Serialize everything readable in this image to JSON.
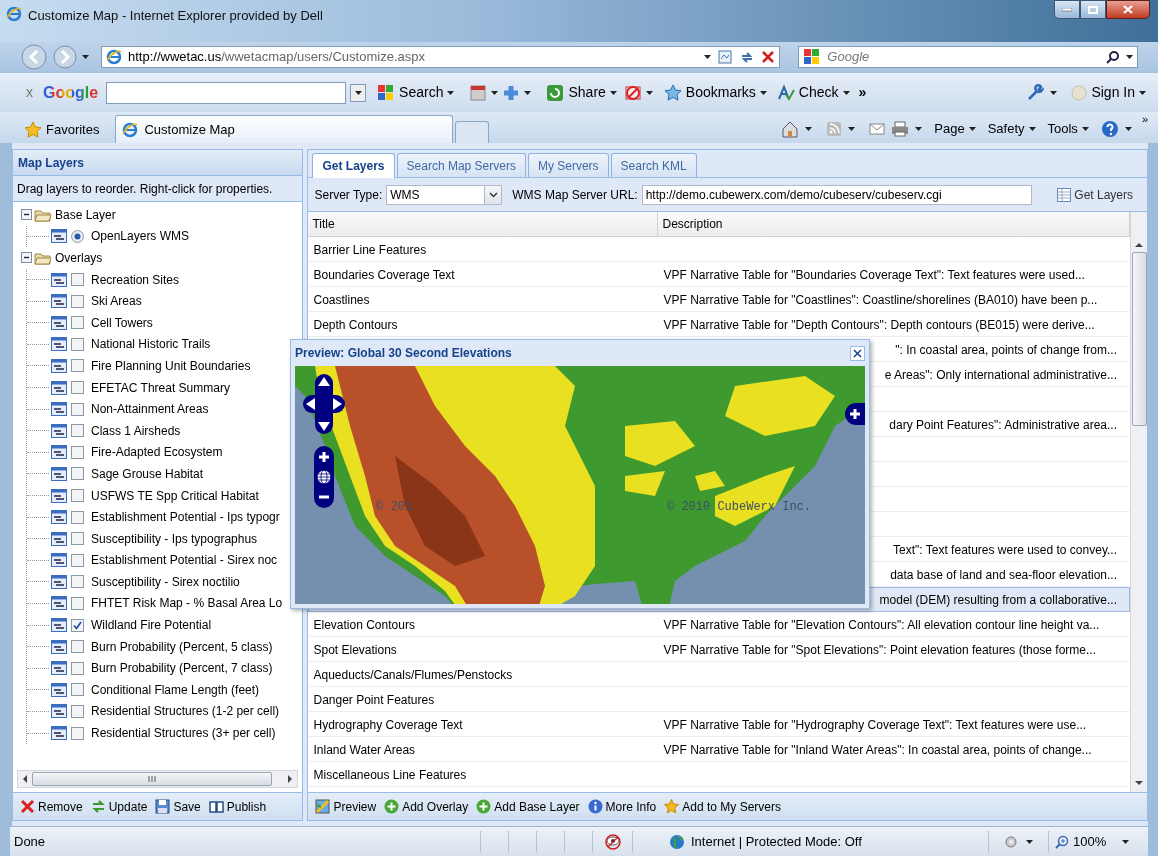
{
  "window": {
    "title": "Customize Map - Internet Explorer provided by Dell"
  },
  "address_bar": {
    "url_host": "http://wwetac.us",
    "url_path": "/wwetacmap/users/Customize.aspx"
  },
  "search_box": {
    "placeholder": "Google"
  },
  "google_toolbar": {
    "close": "x",
    "logo": "Google",
    "items": [
      {
        "label": "Search"
      },
      {
        "label": "Share"
      },
      {
        "label": "Bookmarks"
      },
      {
        "label": "Check"
      }
    ],
    "more": "»",
    "sign_in": "Sign In"
  },
  "favorites_bar": {
    "favorites": "Favorites",
    "tabs": [
      {
        "label": "Customize Map",
        "selected": true
      }
    ],
    "commands": [
      "Page",
      "Safety",
      "Tools"
    ],
    "more": "»"
  },
  "left_panel": {
    "title": "Map Layers",
    "hint": "Drag layers to reorder. Right-click for properties.",
    "tree": [
      {
        "label": "Base Layer",
        "expanded": true,
        "children": [
          {
            "label": "OpenLayers WMS",
            "kind": "radio",
            "checked": true
          }
        ]
      },
      {
        "label": "Overlays",
        "expanded": true,
        "children": [
          {
            "label": "Recreation Sites",
            "kind": "checkbox",
            "checked": false
          },
          {
            "label": "Ski Areas",
            "kind": "checkbox",
            "checked": false
          },
          {
            "label": "Cell Towers",
            "kind": "checkbox",
            "checked": false
          },
          {
            "label": "National Historic Trails",
            "kind": "checkbox",
            "checked": false
          },
          {
            "label": "Fire Planning Unit Boundaries",
            "kind": "checkbox",
            "checked": false
          },
          {
            "label": "EFETAC Threat Summary",
            "kind": "checkbox",
            "checked": false
          },
          {
            "label": "Non-Attainment Areas",
            "kind": "checkbox",
            "checked": false
          },
          {
            "label": "Class 1 Airsheds",
            "kind": "checkbox",
            "checked": false
          },
          {
            "label": "Fire-Adapted Ecosystem",
            "kind": "checkbox",
            "checked": false
          },
          {
            "label": "Sage Grouse Habitat",
            "kind": "checkbox",
            "checked": false
          },
          {
            "label": "USFWS TE Spp Critical Habitat",
            "kind": "checkbox",
            "checked": false
          },
          {
            "label": "Establishment Potential - Ips typogr",
            "kind": "checkbox",
            "checked": false
          },
          {
            "label": "Susceptibility - Ips typographus",
            "kind": "checkbox",
            "checked": false
          },
          {
            "label": "Establishment Potential - Sirex noc",
            "kind": "checkbox",
            "checked": false
          },
          {
            "label": "Susceptibility - Sirex noctilio",
            "kind": "checkbox",
            "checked": false
          },
          {
            "label": "FHTET Risk Map - % Basal Area Lo",
            "kind": "checkbox",
            "checked": false
          },
          {
            "label": "Wildland Fire Potential",
            "kind": "checkbox",
            "checked": true
          },
          {
            "label": "Burn Probability (Percent, 5 class)",
            "kind": "checkbox",
            "checked": false
          },
          {
            "label": "Burn Probability (Percent, 7 class)",
            "kind": "checkbox",
            "checked": false
          },
          {
            "label": "Conditional Flame Length (feet)",
            "kind": "checkbox",
            "checked": false
          },
          {
            "label": "Residential Structures (1-2 per cell)",
            "kind": "checkbox",
            "checked": false
          },
          {
            "label": "Residential Structures (3+ per cell)",
            "kind": "checkbox",
            "checked": false
          }
        ]
      }
    ],
    "toolbar": [
      {
        "kind": "remove",
        "label": "Remove"
      },
      {
        "kind": "update",
        "label": "Update"
      },
      {
        "kind": "save",
        "label": "Save"
      },
      {
        "kind": "publish",
        "label": "Publish"
      }
    ]
  },
  "right_panel": {
    "tabs": [
      {
        "label": "Get Layers",
        "selected": true
      },
      {
        "label": "Search Map Servers",
        "selected": false
      },
      {
        "label": "My Servers",
        "selected": false
      },
      {
        "label": "Search KML",
        "selected": false
      }
    ],
    "server_type_label": "Server Type:",
    "server_type": "WMS",
    "url_label": "WMS Map Server URL:",
    "url": "http://demo.cubewerx.com/demo/cubeserv/cubeserv.cgi",
    "get_layers": "Get Layers",
    "table": {
      "columns": [
        "Title",
        "Description"
      ],
      "rows": [
        {
          "kind": "full",
          "selected": false,
          "title": "Barrier Line Features"
        },
        {
          "kind": "full",
          "selected": false,
          "title": "Boundaries Coverage Text",
          "description": "VPF Narrative Table for \"Boundaries Coverage Text\": Text features were used..."
        },
        {
          "kind": "full",
          "selected": false,
          "title": "Coastlines",
          "description": "VPF Narrative Table for \"Coastlines\": Coastline/shorelines (BA010) have been p..."
        },
        {
          "kind": "full",
          "selected": false,
          "title": "Depth Contours",
          "description": "VPF Narrative Table for \"Depth Contours\": Depth contours (BE015) were derive..."
        },
        {
          "kind": "covered",
          "selected": false,
          "description": "\": In coastal area, points of change from..."
        },
        {
          "kind": "covered",
          "selected": false,
          "description": "e Areas\": Only international administrative..."
        },
        {
          "kind": "covered",
          "selected": false
        },
        {
          "kind": "covered",
          "selected": false,
          "description": "dary Point Features\": Administrative area..."
        },
        {
          "kind": "covered",
          "selected": false
        },
        {
          "kind": "covered",
          "selected": false
        },
        {
          "kind": "covered",
          "selected": false
        },
        {
          "kind": "covered",
          "selected": false
        },
        {
          "kind": "covered",
          "selected": false,
          "description": "Text\": Text features were used to convey..."
        },
        {
          "kind": "covered",
          "selected": false,
          "description": "data base of land and sea-floor elevation..."
        },
        {
          "kind": "covered",
          "selected": true,
          "description": "model (DEM) resulting from a collaborative..."
        },
        {
          "kind": "full",
          "selected": false,
          "title": "Elevation Contours",
          "description": "VPF Narrative Table for \"Elevation Contours\": All elevation contour line height va..."
        },
        {
          "kind": "full",
          "selected": false,
          "title": "Spot Elevations",
          "description": "VPF Narrative Table for \"Spot Elevations\": Point elevation features (those forme..."
        },
        {
          "kind": "full",
          "selected": false,
          "title": "Aqueducts/Canals/Flumes/Penstocks"
        },
        {
          "kind": "full",
          "selected": false,
          "title": "Danger Point Features"
        },
        {
          "kind": "full",
          "selected": false,
          "title": "Hydrography Coverage Text",
          "description": "VPF Narrative Table for \"Hydrography Coverage Text\": Text features were use..."
        },
        {
          "kind": "full",
          "selected": false,
          "title": "Inland Water Areas",
          "description": "VPF Narrative Table for \"Inland Water Areas\": In coastal area, points of change..."
        },
        {
          "kind": "full",
          "selected": false,
          "title": "Miscellaneous Line Features"
        }
      ]
    },
    "toolbar": [
      {
        "kind": "preview",
        "label": "Preview"
      },
      {
        "kind": "add",
        "label": "Add Overlay"
      },
      {
        "kind": "add",
        "label": "Add Base Layer"
      },
      {
        "kind": "info",
        "label": "More Info"
      },
      {
        "kind": "star",
        "label": "Add to My Servers"
      }
    ]
  },
  "preview": {
    "title": "Preview: Global 30 Second Elevations",
    "attributions": [
      "© 201",
      "© 2010 CubeWerx Inc."
    ]
  },
  "status_bar": {
    "text": "Done",
    "zone": "Internet | Protected Mode: Off",
    "zoom": "100%"
  }
}
